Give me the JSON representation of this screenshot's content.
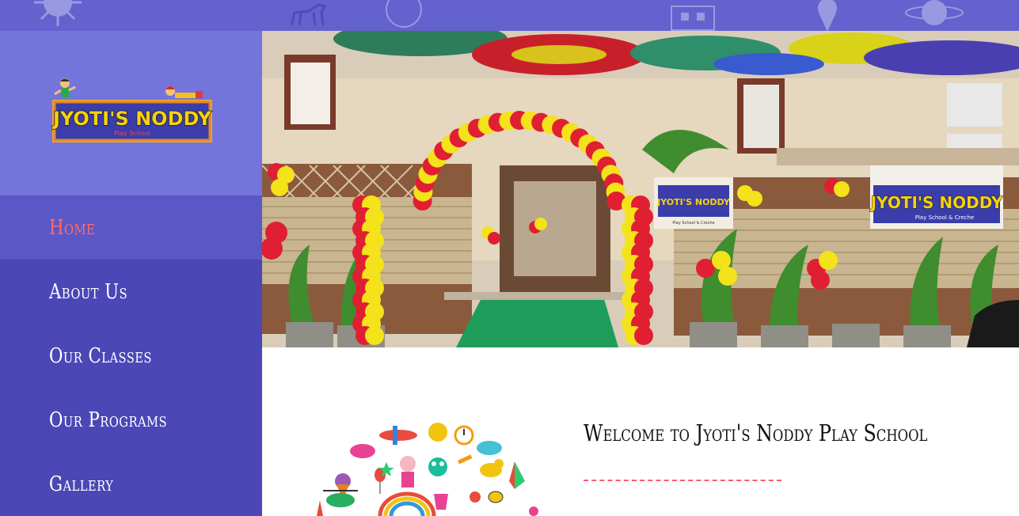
{
  "logo": {
    "title": "JYOTI'S NODDY",
    "subtitle": "Play School"
  },
  "nav": {
    "items": [
      {
        "label": "Home",
        "active": true
      },
      {
        "label": "About Us"
      },
      {
        "label": "Our Classes"
      },
      {
        "label": "Our Programs"
      },
      {
        "label": "Gallery"
      }
    ]
  },
  "hero": {
    "sign_main": "JYOTI'S NODDY",
    "sign_sub": "Play School & Creche",
    "banner_main": "JYOTI'S NODDY",
    "banner_sub": "Play School & Creche"
  },
  "welcome": {
    "title": "Welcome to Jyoti's Noddy Play School"
  },
  "colors": {
    "sidebar": "#4b47b7",
    "logo_bg": "#7475db",
    "active_nav": "#5a57c6",
    "active_text": "#ff6b6b",
    "topbar": "#6362cf",
    "accent_dash": "#ff5a6e"
  }
}
